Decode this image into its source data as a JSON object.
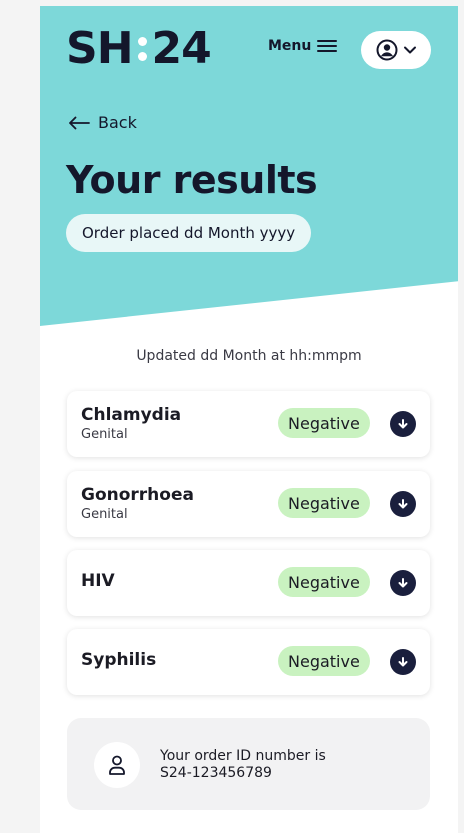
{
  "colors": {
    "hero_bg": "#7dd8d9",
    "navy": "#14172b",
    "badge_negative": "#c9f2c0",
    "pill_bg": "#e8f7f7"
  },
  "header": {
    "logo_left": "SH",
    "logo_right": "24",
    "menu_label": "Menu",
    "menu_icon": "hamburger-icon",
    "account_icon": "user-circle-icon",
    "account_chevron_icon": "chevron-down-icon"
  },
  "nav": {
    "back_label": "Back",
    "back_icon": "arrow-left-icon"
  },
  "page": {
    "title": "Your results",
    "order_placed": "Order placed dd Month yyyy",
    "updated": "Updated dd Month at hh:mmpm"
  },
  "results": [
    {
      "name": "Chlamydia",
      "site": "Genital",
      "status": "Negative"
    },
    {
      "name": "Gonorrhoea",
      "site": "Genital",
      "status": "Negative"
    },
    {
      "name": "HIV",
      "site": "",
      "status": "Negative"
    },
    {
      "name": "Syphilis",
      "site": "",
      "status": "Negative"
    }
  ],
  "order_id": {
    "label": "Your order ID number is",
    "value": "S24-123456789",
    "icon": "user-outline-icon"
  }
}
